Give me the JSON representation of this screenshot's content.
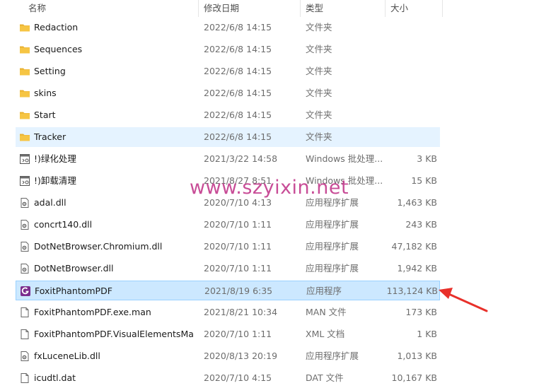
{
  "columns": {
    "name": "名称",
    "date": "修改日期",
    "type": "类型",
    "size": "大小"
  },
  "sort_indicator": "^",
  "rows": [
    {
      "name": "Redaction",
      "date": "2022/6/8 14:15",
      "type": "文件夹",
      "size": "",
      "icon": "folder-icon"
    },
    {
      "name": "Sequences",
      "date": "2022/6/8 14:15",
      "type": "文件夹",
      "size": "",
      "icon": "folder-icon"
    },
    {
      "name": "Setting",
      "date": "2022/6/8 14:15",
      "type": "文件夹",
      "size": "",
      "icon": "folder-icon"
    },
    {
      "name": "skins",
      "date": "2022/6/8 14:15",
      "type": "文件夹",
      "size": "",
      "icon": "folder-icon"
    },
    {
      "name": "Start",
      "date": "2022/6/8 14:15",
      "type": "文件夹",
      "size": "",
      "icon": "folder-icon"
    },
    {
      "name": "Tracker",
      "date": "2022/6/8 14:15",
      "type": "文件夹",
      "size": "",
      "icon": "folder-icon",
      "state": "hover"
    },
    {
      "name": "!)绿化处理",
      "date": "2021/3/22 14:58",
      "type": "Windows 批处理...",
      "size": "3 KB",
      "icon": "batch-file-icon"
    },
    {
      "name": "!)卸载清理",
      "date": "2021/8/27 8:51",
      "type": "Windows 批处理...",
      "size": "15 KB",
      "icon": "batch-file-icon"
    },
    {
      "name": "adal.dll",
      "date": "2020/7/10 4:13",
      "type": "应用程序扩展",
      "size": "1,463 KB",
      "icon": "dll-file-icon"
    },
    {
      "name": "concrt140.dll",
      "date": "2020/7/10 1:11",
      "type": "应用程序扩展",
      "size": "243 KB",
      "icon": "dll-file-icon"
    },
    {
      "name": "DotNetBrowser.Chromium.dll",
      "date": "2020/7/10 1:11",
      "type": "应用程序扩展",
      "size": "47,182 KB",
      "icon": "dll-file-icon"
    },
    {
      "name": "DotNetBrowser.dll",
      "date": "2020/7/10 1:11",
      "type": "应用程序扩展",
      "size": "1,942 KB",
      "icon": "dll-file-icon"
    },
    {
      "name": "FoxitPhantomPDF",
      "date": "2021/8/19 6:35",
      "type": "应用程序",
      "size": "113,124 KB",
      "icon": "foxit-app-icon",
      "state": "selected"
    },
    {
      "name": "FoxitPhantomPDF.exe.man",
      "date": "2021/8/21 10:34",
      "type": "MAN 文件",
      "size": "173 KB",
      "icon": "blank-file-icon"
    },
    {
      "name": "FoxitPhantomPDF.VisualElementsMan...",
      "date": "2020/7/10 1:11",
      "type": "XML 文档",
      "size": "1 KB",
      "icon": "blank-file-icon"
    },
    {
      "name": "fxLuceneLib.dll",
      "date": "2020/8/13 20:19",
      "type": "应用程序扩展",
      "size": "1,013 KB",
      "icon": "dll-file-icon"
    },
    {
      "name": "icudtl.dat",
      "date": "2020/7/10 4:15",
      "type": "DAT 文件",
      "size": "10,167 KB",
      "icon": "blank-file-icon"
    }
  ],
  "watermark": "www.szyixin.net",
  "colors": {
    "hover": "#e5f3ff",
    "selected": "#cce8ff",
    "folder": "#f6c544",
    "watermark": "#c33a8c",
    "arrow": "#e8302a"
  }
}
